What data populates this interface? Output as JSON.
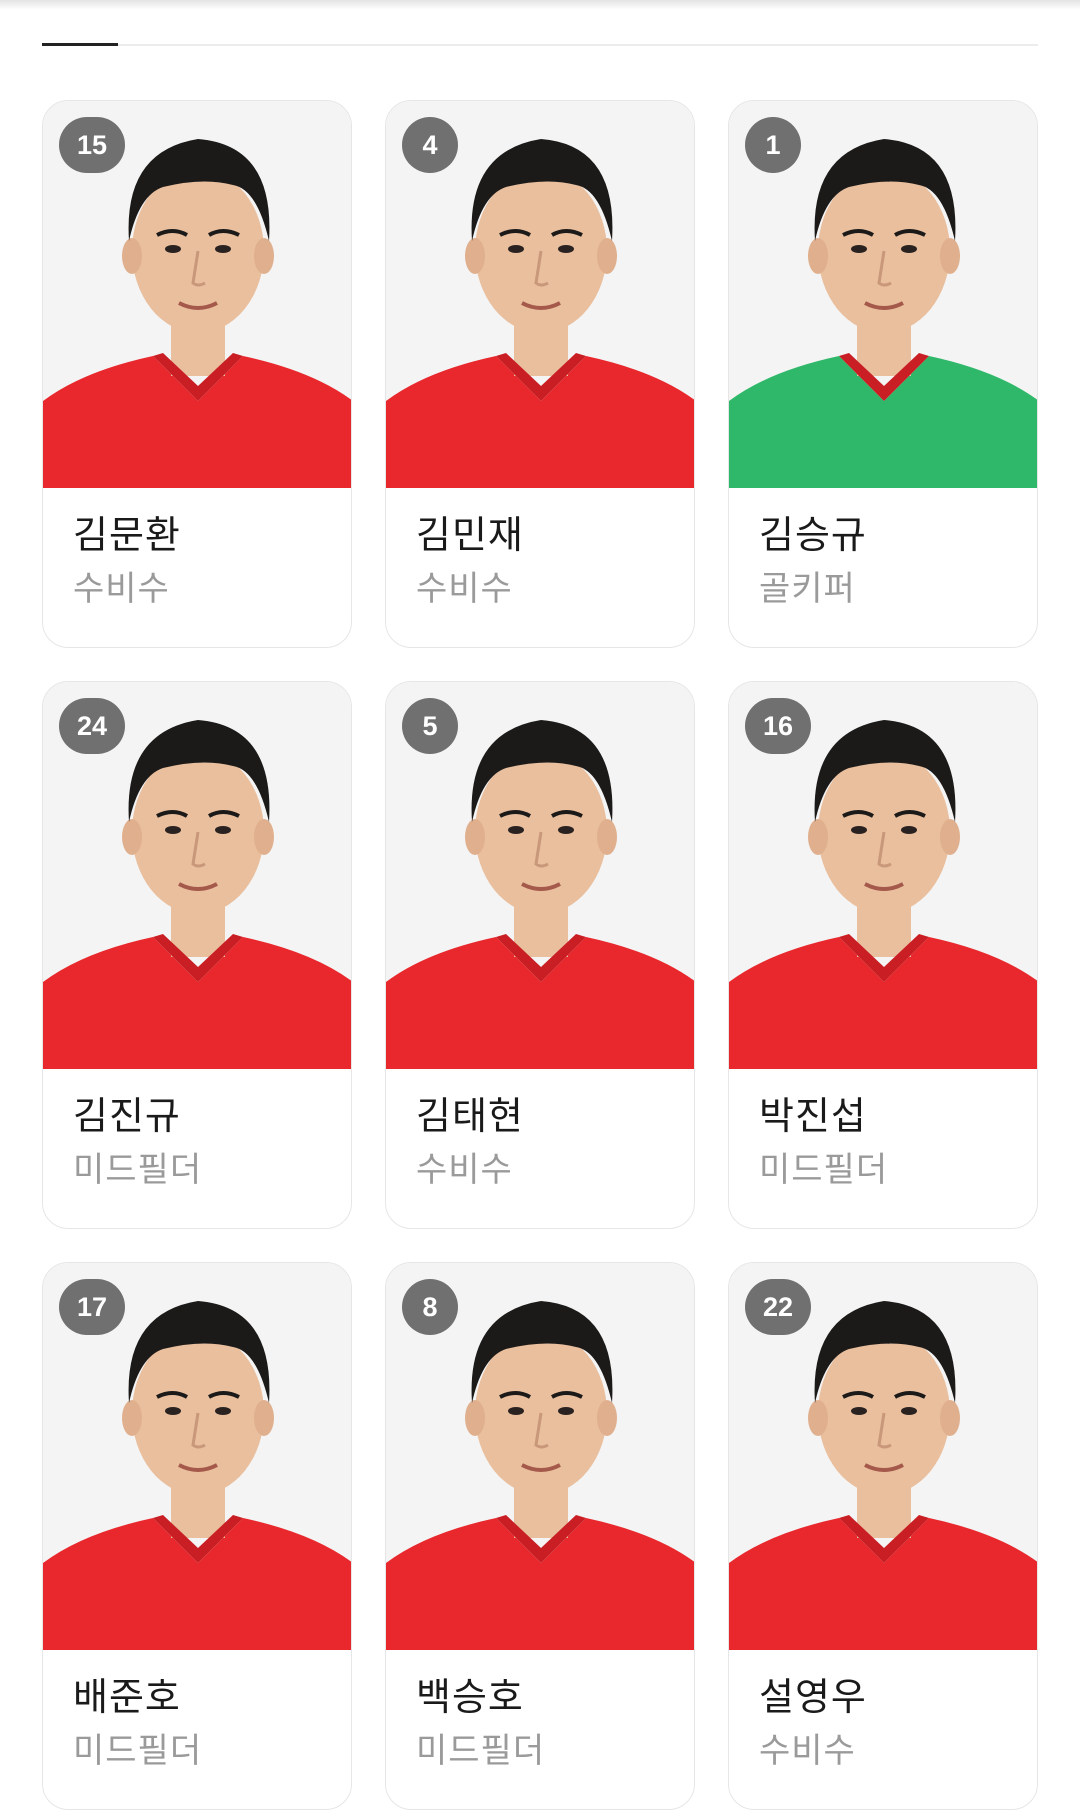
{
  "players": [
    {
      "number": "15",
      "name": "김문환",
      "position": "수비수",
      "jersey_color": "#e8282c"
    },
    {
      "number": "4",
      "name": "김민재",
      "position": "수비수",
      "jersey_color": "#e8282c"
    },
    {
      "number": "1",
      "name": "김승규",
      "position": "골키퍼",
      "jersey_color": "#2fb86a"
    },
    {
      "number": "24",
      "name": "김진규",
      "position": "미드필더",
      "jersey_color": "#e8282c"
    },
    {
      "number": "5",
      "name": "김태현",
      "position": "수비수",
      "jersey_color": "#e8282c"
    },
    {
      "number": "16",
      "name": "박진섭",
      "position": "미드필더",
      "jersey_color": "#e8282c"
    },
    {
      "number": "17",
      "name": "배준호",
      "position": "미드필더",
      "jersey_color": "#e8282c"
    },
    {
      "number": "8",
      "name": "백승호",
      "position": "미드필더",
      "jersey_color": "#e8282c"
    },
    {
      "number": "22",
      "name": "설영우",
      "position": "수비수",
      "jersey_color": "#e8282c"
    }
  ],
  "colors": {
    "badge_bg": "#707070",
    "photo_bg": "#f4f4f4",
    "skin": "#e9bf9e",
    "hair": "#1c1a19"
  }
}
